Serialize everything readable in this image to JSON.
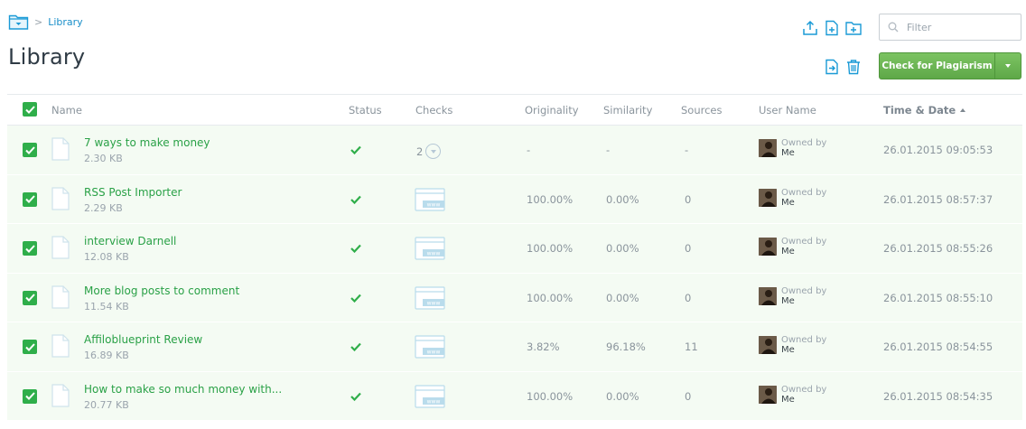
{
  "breadcrumb": {
    "link": "Library"
  },
  "page_title": "Library",
  "filter": {
    "placeholder": "Filter",
    "value": ""
  },
  "check_button": {
    "label": "Check for Plagiarism"
  },
  "columns": {
    "name": "Name",
    "status": "Status",
    "checks": "Checks",
    "originality": "Originality",
    "similarity": "Similarity",
    "sources": "Sources",
    "user": "User Name",
    "time": "Time & Date"
  },
  "owner": {
    "label": "Owned by",
    "name": "Me"
  },
  "colors": {
    "accent_green": "#2fae4a",
    "link_blue": "#1a8fc9",
    "row_bg": "#f4fbf3"
  },
  "rows": [
    {
      "name": "7 ways to make money",
      "size": "2.30 KB",
      "checks": "2",
      "originality": "-",
      "similarity": "-",
      "sources": "-",
      "datetime": "26.01.2015 09:05:53"
    },
    {
      "name": "RSS Post Importer",
      "size": "2.29 KB",
      "originality": "100.00%",
      "similarity": "0.00%",
      "sources": "0",
      "datetime": "26.01.2015 08:57:37"
    },
    {
      "name": "interview Darnell",
      "size": "12.08 KB",
      "originality": "100.00%",
      "similarity": "0.00%",
      "sources": "0",
      "datetime": "26.01.2015 08:55:26"
    },
    {
      "name": "More blog posts to comment",
      "size": "11.54 KB",
      "originality": "100.00%",
      "similarity": "0.00%",
      "sources": "0",
      "datetime": "26.01.2015 08:55:10"
    },
    {
      "name": "Affiloblueprint Review",
      "size": "16.89 KB",
      "originality": "3.82%",
      "similarity": "96.18%",
      "sources": "11",
      "datetime": "26.01.2015 08:54:55"
    },
    {
      "name": "How to make so much money with...",
      "size": "20.77 KB",
      "originality": "100.00%",
      "similarity": "0.00%",
      "sources": "0",
      "datetime": "26.01.2015 08:54:35"
    }
  ]
}
